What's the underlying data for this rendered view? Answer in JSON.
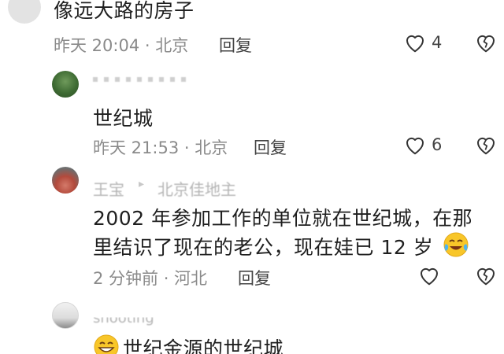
{
  "comments": [
    {
      "text": "像远大路的房子",
      "time": "昨天 20:04 · 北京",
      "reply": "回复",
      "likes": "4"
    },
    {
      "text": "世纪城",
      "time": "昨天 21:53 · 北京",
      "reply": "回复",
      "likes": "6"
    },
    {
      "name": "王宝",
      "reply_to": "北京佳地主",
      "line1": "2002 年参加工作的单位就在世纪城，在那",
      "line2": "里结识了现在的老公，现在娃已 12 岁",
      "time": "2 分钟前 · 河北",
      "reply": "回复"
    },
    {
      "name": "shooting",
      "text": "世纪金源的世纪城"
    }
  ],
  "icons": {
    "like": "heart-outline-icon",
    "dislike": "broken-heart-outline-icon",
    "emoji_laugh": "laughing-tears-emoji",
    "emoji_grin": "grinning-emoji"
  }
}
